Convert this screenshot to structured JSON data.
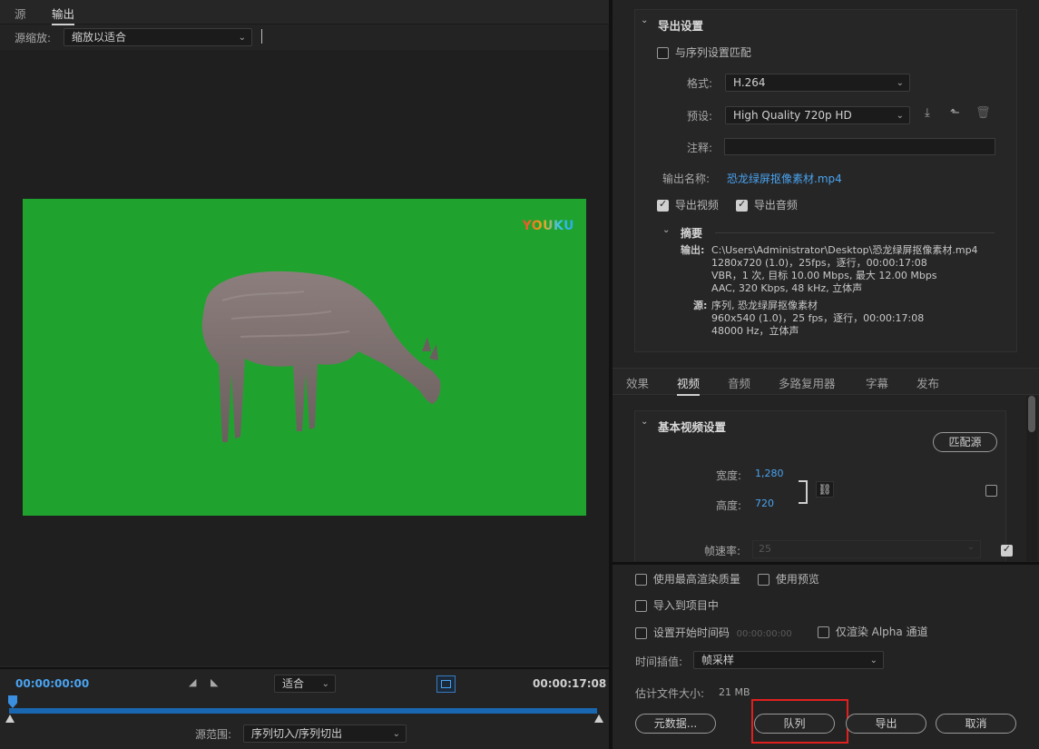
{
  "left": {
    "tabs": [
      {
        "label": "源"
      },
      {
        "label": "输出"
      }
    ],
    "source_scale_label": "源缩放:",
    "source_scale_value": "缩放以适合",
    "watermark": "YOUKU",
    "current_timecode": "00:00:00:00",
    "fit_value": "适合",
    "duration_timecode": "00:00:17:08",
    "source_range_label": "源范围:",
    "source_range_value": "序列切入/序列切出"
  },
  "export_settings": {
    "title": "导出设置",
    "match_sequence_label": "与序列设置匹配",
    "format_label": "格式:",
    "format_value": "H.264",
    "preset_label": "预设:",
    "preset_value": "High Quality 720p HD",
    "comments_label": "注释:",
    "comments_value": "",
    "output_name_label": "输出名称:",
    "output_name_value": "恐龙绿屏抠像素材.mp4",
    "export_video_label": "导出视频",
    "export_audio_label": "导出音频",
    "summary_title": "摘要",
    "summary_output_label": "输出:",
    "summary_output_lines": [
      "C:\\Users\\Administrator\\Desktop\\恐龙绿屏抠像素材.mp4",
      "1280x720 (1.0)，25fps，逐行，00:00:17:08",
      "VBR，1 次, 目标 10.00 Mbps, 最大 12.00 Mbps",
      "AAC, 320 Kbps, 48  kHz, 立体声"
    ],
    "summary_source_label": "源:",
    "summary_source_lines": [
      "序列, 恐龙绿屏抠像素材",
      "960x540 (1.0)，25 fps，逐行，00:00:17:08",
      "48000 Hz，立体声"
    ]
  },
  "settings_tabs": [
    {
      "label": "效果"
    },
    {
      "label": "视频"
    },
    {
      "label": "音频"
    },
    {
      "label": "多路复用器"
    },
    {
      "label": "字幕"
    },
    {
      "label": "发布"
    }
  ],
  "video_settings": {
    "title": "基本视频设置",
    "match_source_button": "匹配源",
    "width_label": "宽度:",
    "width_value": "1,280",
    "height_label": "高度:",
    "height_value": "720",
    "frame_rate_label": "帧速率:",
    "frame_rate_value": "25"
  },
  "bottom": {
    "max_render_label": "使用最高渲染质量",
    "use_previews_label": "使用预览",
    "import_project_label": "导入到项目中",
    "start_timecode_label": "设置开始时间码",
    "start_timecode_value": "00:00:00:00",
    "alpha_only_label": "仅渲染 Alpha 通道",
    "time_interp_label": "时间插值:",
    "time_interp_value": "帧采样",
    "est_size_label": "估计文件大小:",
    "est_size_value": "21 MB",
    "metadata_button": "元数据...",
    "queue_button": "队列",
    "export_button": "导出",
    "cancel_button": "取消"
  },
  "colors": {
    "accent": "#4aa3f0",
    "video_bg": "#1fa32e",
    "highlight": "#e0201e",
    "scrub_bar": "#1967b0"
  }
}
